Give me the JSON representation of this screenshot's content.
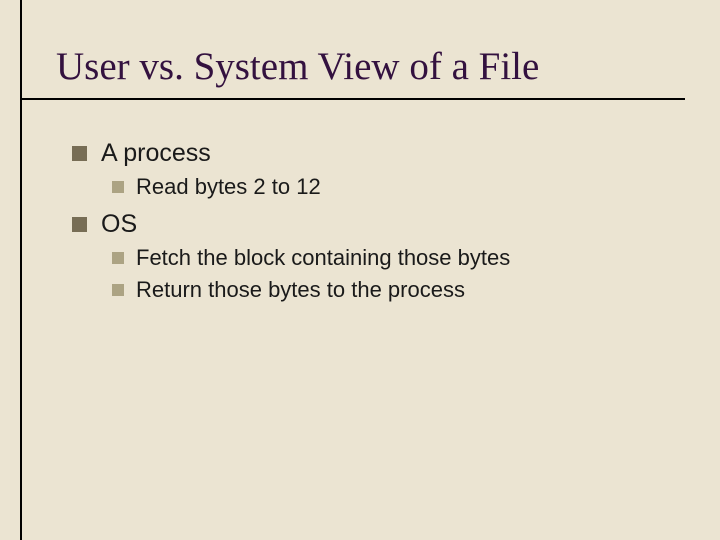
{
  "title": "User vs. System View of a File",
  "items": [
    {
      "label": "A process",
      "children": [
        {
          "label": "Read bytes 2 to 12"
        }
      ]
    },
    {
      "label": "OS",
      "children": [
        {
          "label": "Fetch the block containing those bytes"
        },
        {
          "label": "Return those bytes to the process"
        }
      ]
    }
  ]
}
